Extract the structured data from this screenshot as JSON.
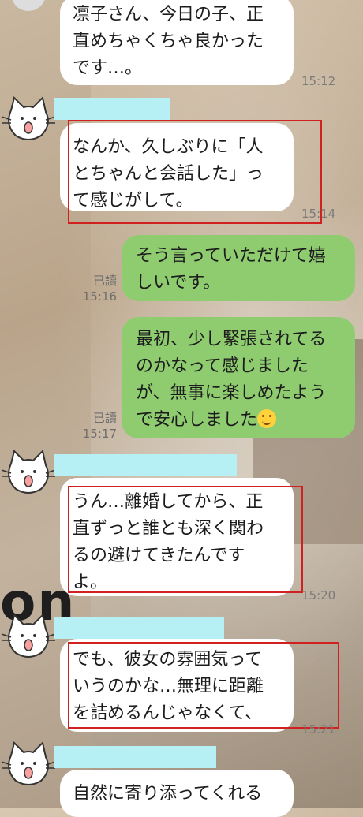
{
  "background": {
    "overlay_text": "on"
  },
  "messages": [
    {
      "id": "m1",
      "side": "left",
      "text_lines": [
        "凛子さん、今日の子、正",
        "直めちゃくちゃ良かった",
        "です…。"
      ],
      "time": "15:12"
    },
    {
      "id": "m2",
      "side": "left",
      "text_lines": [
        "なんか、久しぶりに「人",
        "とちゃんと会話した」っ",
        "て感じがして。"
      ],
      "time": "15:14"
    },
    {
      "id": "m3",
      "side": "right",
      "text_lines": [
        "そう言っていただけて嬉",
        "しいです。"
      ],
      "read": "已讀",
      "time": "15:16"
    },
    {
      "id": "m4",
      "side": "right",
      "text_lines": [
        "最初、少し緊張されてる",
        "のかなって感じました",
        "が、無事に楽しめたよう",
        "で安心しました"
      ],
      "emoji": "smiling-face-icon",
      "read": "已讀",
      "time": "15:17"
    },
    {
      "id": "m5",
      "side": "left",
      "text_lines": [
        "うん…離婚してから、正",
        "直ずっと誰とも深く関わ",
        "るの避けてきたんです",
        "よ。"
      ],
      "time": "15:20"
    },
    {
      "id": "m6",
      "side": "left",
      "text_lines": [
        "でも、彼女の雰囲気って",
        "いうのかな…無理に距離",
        "を詰めるんじゃなくて、"
      ],
      "time": "15:21"
    },
    {
      "id": "m7",
      "side": "left",
      "text_lines": [
        "自然に寄り添ってくれる"
      ]
    }
  ],
  "colors": {
    "sent_bubble": "#8fcc70",
    "received_bubble": "#ffffff",
    "name_redaction": "#b6f0f4",
    "highlight_box": "#d02020"
  }
}
